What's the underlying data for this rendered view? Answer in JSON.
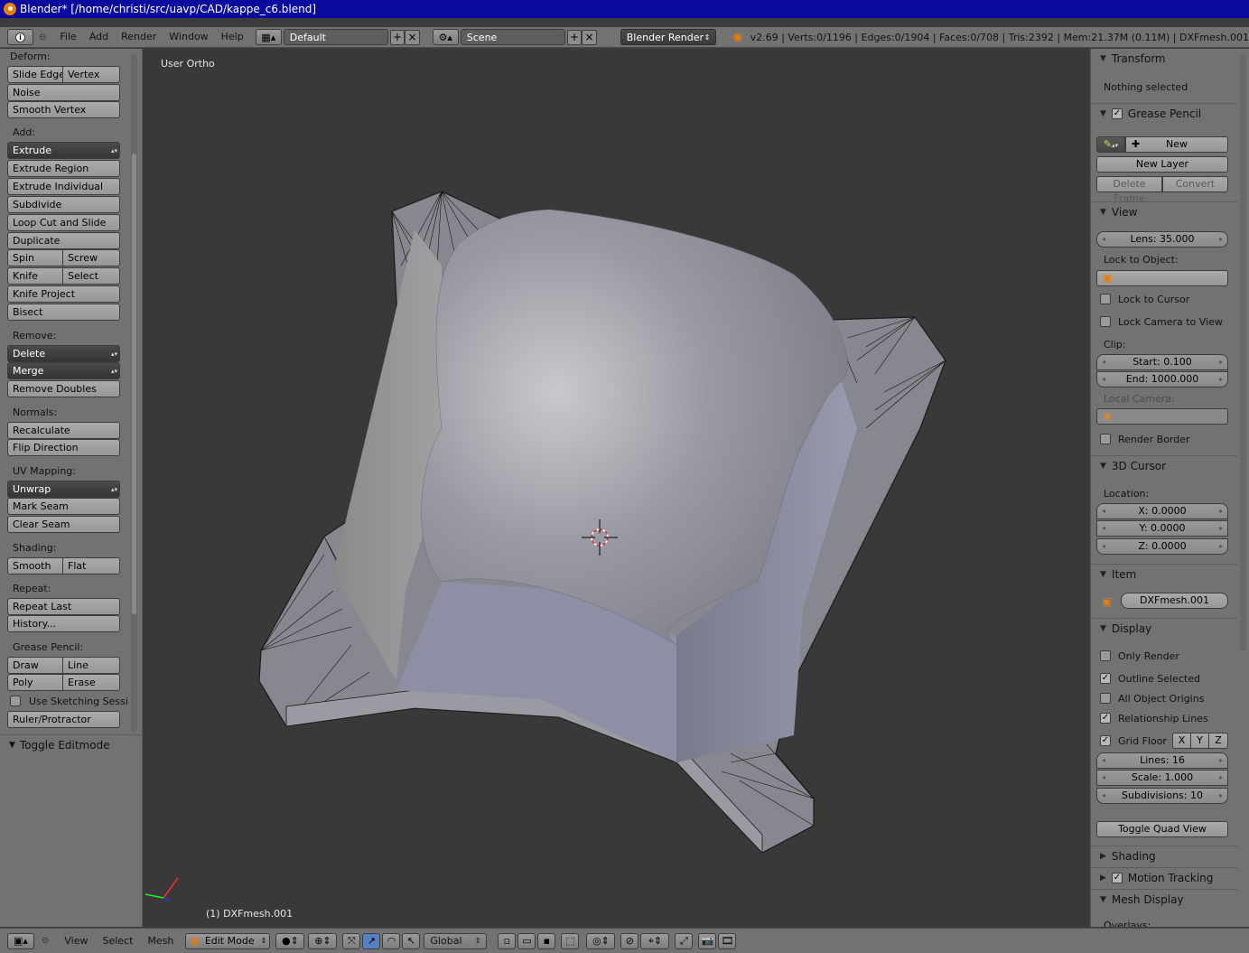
{
  "window": {
    "title": "Blender* [/home/christi/src/uavp/CAD/kappe_c6.blend]"
  },
  "topbar": {
    "menus": [
      "File",
      "Add",
      "Render",
      "Window",
      "Help"
    ],
    "layout": "Default",
    "scene": "Scene",
    "engine": "Blender Render",
    "status": "v2.69 | Verts:0/1196 | Edges:0/1904 | Faces:0/708 | Tris:2392 | Mem:21.37M (0.11M) | DXFmesh.001"
  },
  "tools": {
    "deform": {
      "label": "Deform:",
      "slide_edge": "Slide Edge",
      "vertex": "Vertex",
      "noise": "Noise",
      "smooth_vertex": "Smooth Vertex"
    },
    "add": {
      "label": "Add:",
      "extrude": "Extrude",
      "extrude_region": "Extrude Region",
      "extrude_individual": "Extrude Individual",
      "subdivide": "Subdivide",
      "loop_cut": "Loop Cut and Slide",
      "duplicate": "Duplicate",
      "spin": "Spin",
      "screw": "Screw",
      "knife": "Knife",
      "select": "Select",
      "knife_project": "Knife Project",
      "bisect": "Bisect"
    },
    "remove": {
      "label": "Remove:",
      "delete": "Delete",
      "merge": "Merge",
      "remove_doubles": "Remove Doubles"
    },
    "normals": {
      "label": "Normals:",
      "recalculate": "Recalculate",
      "flip_direction": "Flip Direction"
    },
    "uv": {
      "label": "UV Mapping:",
      "unwrap": "Unwrap",
      "mark_seam": "Mark Seam",
      "clear_seam": "Clear Seam"
    },
    "shading": {
      "label": "Shading:",
      "smooth": "Smooth",
      "flat": "Flat"
    },
    "repeat": {
      "label": "Repeat:",
      "repeat_last": "Repeat Last",
      "history": "History..."
    },
    "grease": {
      "label": "Grease Pencil:",
      "draw": "Draw",
      "line": "Line",
      "poly": "Poly",
      "erase": "Erase",
      "sketching": "Use Sketching Sessi",
      "ruler": "Ruler/Protractor"
    },
    "toggle_editmode": "Toggle Editmode"
  },
  "viewport": {
    "view_label": "User Ortho",
    "object_label": "(1) DXFmesh.001"
  },
  "props": {
    "transform": {
      "title": "Transform",
      "nothing": "Nothing selected"
    },
    "grease": {
      "title": "Grease Pencil",
      "new": "New",
      "new_layer": "New Layer",
      "delete_frame": "Delete Frame",
      "convert": "Convert"
    },
    "view": {
      "title": "View",
      "lens": "Lens: 35.000",
      "lock_object": "Lock to Object:",
      "lock_cursor": "Lock to Cursor",
      "lock_camera": "Lock Camera to View",
      "clip": "Clip:",
      "start": "Start: 0.100",
      "end": "End: 1000.000",
      "local_camera": "Local Camera:",
      "render_border": "Render Border"
    },
    "cursor": {
      "title": "3D Cursor",
      "location": "Location:",
      "x": "X: 0.0000",
      "y": "Y: 0.0000",
      "z": "Z: 0.0000"
    },
    "item": {
      "title": "Item",
      "name": "DXFmesh.001"
    },
    "display": {
      "title": "Display",
      "only_render": "Only Render",
      "outline_selected": "Outline Selected",
      "all_origins": "All Object Origins",
      "relationship": "Relationship Lines",
      "grid_floor": "Grid Floor",
      "x": "X",
      "y": "Y",
      "z": "Z",
      "lines": "Lines: 16",
      "scale": "Scale: 1.000",
      "subdivisions": "Subdivisions: 10",
      "toggle_quad": "Toggle Quad View"
    },
    "shading": {
      "title": "Shading"
    },
    "motion": {
      "title": "Motion Tracking"
    },
    "mesh_display": {
      "title": "Mesh Display",
      "overlays": "Overlays:"
    }
  },
  "bottombar": {
    "menus": [
      "View",
      "Select",
      "Mesh"
    ],
    "mode": "Edit Mode",
    "orientation": "Global"
  }
}
